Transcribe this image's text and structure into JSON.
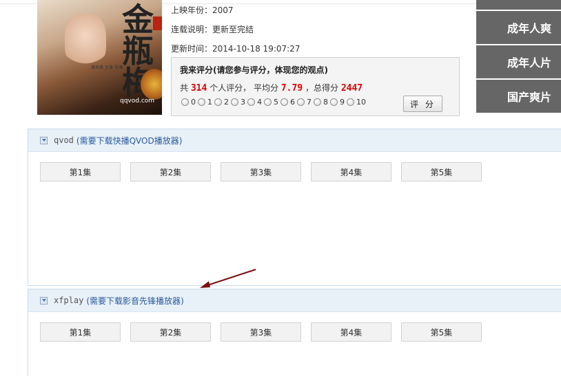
{
  "info": {
    "year": "上映年份：2007",
    "status": "连载说明：更新至完结",
    "updated": "更新时间：2014-10-18 19:07:27"
  },
  "poster": {
    "title_chars": "金瓶梅",
    "side_text": "演员表 主演 导演",
    "watermark": "qqvod.com"
  },
  "rating": {
    "title": "我来评分(请您参与评分，体现您的观点)",
    "prefix": "共",
    "count": "314",
    "count_suffix": "个人评分，",
    "avg_label": "平均分",
    "avg": "7.79",
    "total_label": "，总得分",
    "total": "2447",
    "options": [
      "0",
      "1",
      "2",
      "3",
      "4",
      "5",
      "6",
      "7",
      "8",
      "9",
      "10"
    ],
    "submit": "评 分"
  },
  "sidebar": {
    "items": [
      {
        "label": "成年人爽"
      },
      {
        "label": "成年人片"
      },
      {
        "label": "国产爽片"
      }
    ]
  },
  "players": [
    {
      "name": "qvod",
      "open": "(",
      "link": "需要下载快播QVOD播放器",
      "close": ")",
      "episodes": [
        "第1集",
        "第2集",
        "第3集",
        "第4集",
        "第5集"
      ]
    },
    {
      "name": "xfplay",
      "open": "(",
      "link": "需要下载影音先锋播放器",
      "close": ")",
      "episodes": [
        "第1集",
        "第2集",
        "第3集",
        "第4集",
        "第5集"
      ]
    }
  ],
  "colors": {
    "sidebar_bg": "#666666",
    "panel_head_bg": "#e8f0f8",
    "rating_red": "#dd0000",
    "link_blue": "#2a5a9a",
    "arrow": "#7a1010"
  }
}
